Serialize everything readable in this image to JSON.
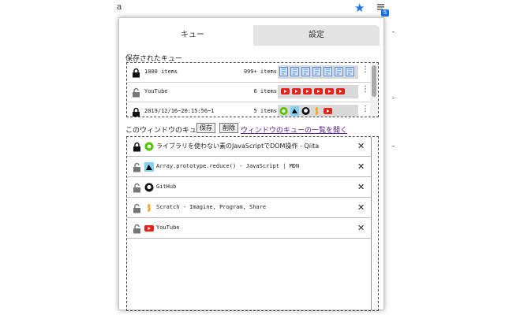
{
  "browser": {
    "url_fragment": "a",
    "star_icon": "star-icon",
    "extension_badge": "5"
  },
  "tabs": [
    {
      "label": "キュー",
      "active": true
    },
    {
      "label": "設定",
      "active": false
    }
  ],
  "saved_queues": {
    "heading": "保存されたキュー",
    "rows": [
      {
        "name": "1000 items",
        "count": "999+ items",
        "locked": true
      },
      {
        "name": "YouTube",
        "count": "6 items",
        "locked": false
      },
      {
        "name": "2019/12/16~20:15:56~1",
        "count": "5 items",
        "locked": true
      }
    ],
    "menu_glyph": "⋮"
  },
  "window_queue": {
    "heading": "このウィンドウのキュー",
    "save_label": "保存",
    "delete_label": "削除",
    "open_list_link": "ウィンドウのキューの一覧を開く",
    "items": [
      {
        "title": "ライブラリを使わない素のJavaScriptでDOM操作 - Qiita",
        "icon": "qiita-icon",
        "jp": true
      },
      {
        "title": "Array.prototype.reduce() - JavaScript | MDN",
        "icon": "mdn-icon",
        "jp": false
      },
      {
        "title": "GitHub",
        "icon": "github-icon",
        "jp": false
      },
      {
        "title": "Scratch - Imagine, Program, Share",
        "icon": "scratch-icon",
        "jp": false
      },
      {
        "title": "YouTube",
        "icon": "youtube-icon",
        "jp": false
      }
    ],
    "close_glyph": "✕"
  },
  "colors": {
    "link": "#551a8b",
    "youtube_red": "#e62117",
    "qiita_green": "#55c500",
    "doc_blue": "#5b8fd8",
    "chrome_blue": "#1a73e8"
  }
}
